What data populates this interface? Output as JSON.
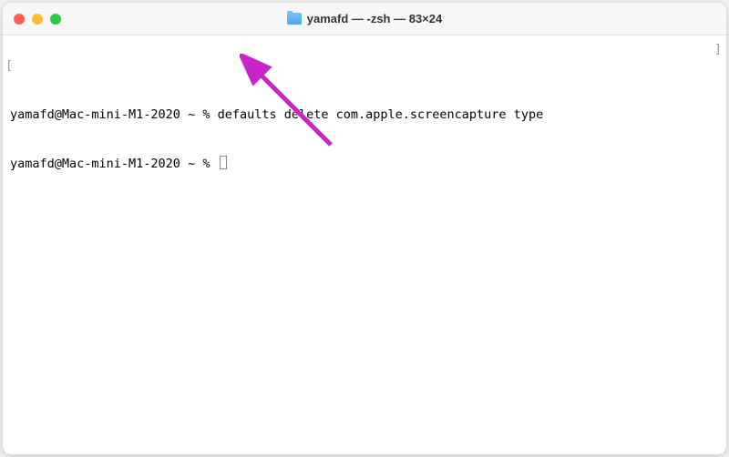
{
  "window": {
    "title": "yamafd — -zsh — 83×24",
    "folder_icon_name": "folder-icon"
  },
  "terminal": {
    "lines": [
      {
        "prompt": "yamafd@Mac-mini-M1-2020 ~ % ",
        "command": "defaults delete com.apple.screencapture type"
      },
      {
        "prompt": "yamafd@Mac-mini-M1-2020 ~ % ",
        "command": ""
      }
    ],
    "left_bracket": "[",
    "right_bracket": "]"
  },
  "annotation": {
    "arrow_color": "#c824c8"
  }
}
